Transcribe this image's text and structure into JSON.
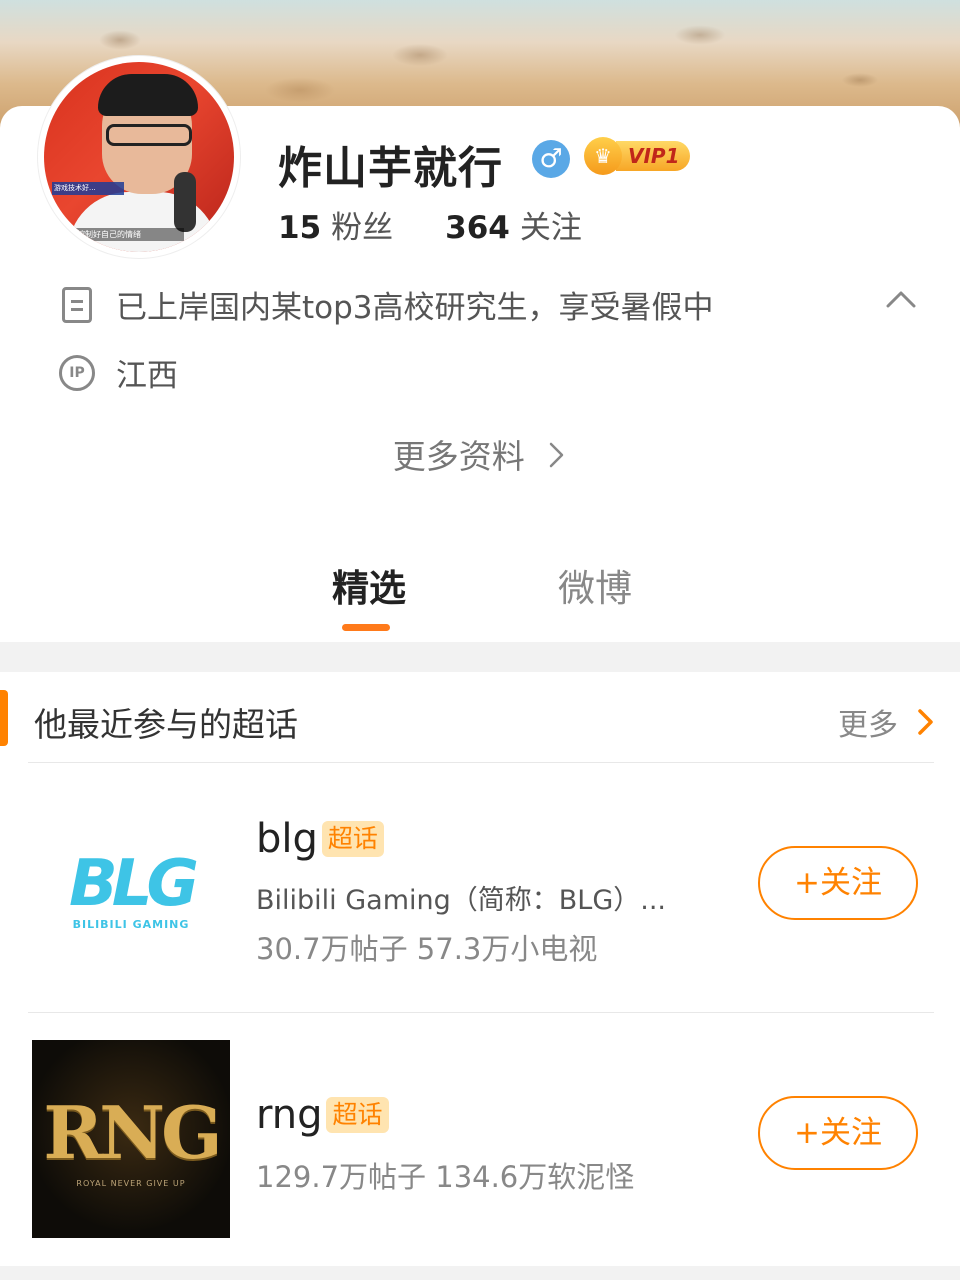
{
  "profile": {
    "name": "炸山芋就行",
    "gender_symbol": "♂",
    "vip_label": "VIP1",
    "fans_count": "15",
    "fans_label": "粉丝",
    "following_count": "364",
    "following_label": "关注",
    "bio": "已上岸国内某top3高校研究生，享受暑假中",
    "ip_location": "江西",
    "ip_icon_text": "IP",
    "more_info_label": "更多资料",
    "avatar_caption_top": "游戏技术好...",
    "avatar_caption_bottom": "控制好自己的情绪"
  },
  "tabs": [
    {
      "label": "精选",
      "active": true
    },
    {
      "label": "微博",
      "active": false
    }
  ],
  "super_topics": {
    "section_title": "他最近参与的超话",
    "more_label": "更多",
    "items": [
      {
        "name": "blg",
        "tag": "超话",
        "description": "Bilibili Gaming（简称：BLG）...",
        "stats": "30.7万帖子 57.3万小电视",
        "follow_label": "+关注",
        "logo_text": "BLG",
        "logo_subtext": "BILIBILI GAMING"
      },
      {
        "name": "rng",
        "tag": "超话",
        "stats": "129.7万帖子 134.6万软泥怪",
        "follow_label": "+关注",
        "logo_text": "RNG",
        "logo_subtext": "ROYAL NEVER GIVE UP"
      }
    ]
  },
  "colors": {
    "accent": "#ff8200",
    "gender_badge": "#5aa8e6",
    "tag_bg": "#ffe4b0"
  }
}
